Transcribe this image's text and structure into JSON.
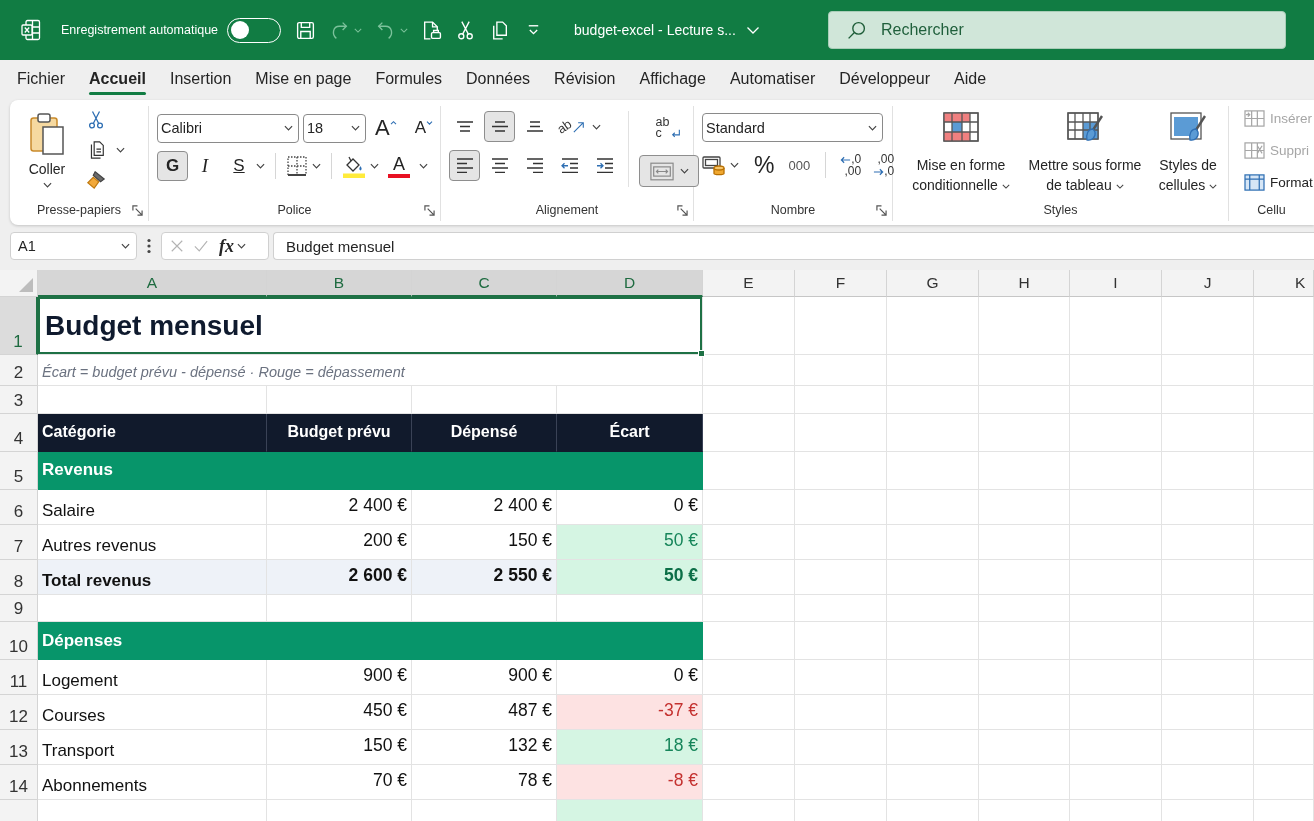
{
  "title_bar": {
    "autosave_label": "Enregistrement automatique",
    "autosave_on": false,
    "quick_access": [
      {
        "kind": "save",
        "disabled": false,
        "caret": false
      },
      {
        "kind": "redo",
        "disabled": true,
        "caret": true
      },
      {
        "kind": "undo",
        "disabled": true,
        "caret": true
      },
      {
        "kind": "print",
        "disabled": false,
        "caret": false
      },
      {
        "kind": "cut",
        "disabled": false,
        "caret": false
      },
      {
        "kind": "copy",
        "disabled": false,
        "caret": false
      },
      {
        "kind": "customize",
        "disabled": false,
        "caret": false
      }
    ],
    "document_title": "budget-excel - Lecture s...",
    "search_placeholder": "Rechercher"
  },
  "menu_tabs": [
    {
      "label": "Fichier",
      "selected": false
    },
    {
      "label": "Accueil",
      "selected": true
    },
    {
      "label": "Insertion",
      "selected": false
    },
    {
      "label": "Mise en page",
      "selected": false
    },
    {
      "label": "Formules",
      "selected": false
    },
    {
      "label": "Données",
      "selected": false
    },
    {
      "label": "Révision",
      "selected": false
    },
    {
      "label": "Affichage",
      "selected": false
    },
    {
      "label": "Automatiser",
      "selected": false
    },
    {
      "label": "Développeur",
      "selected": false
    },
    {
      "label": "Aide",
      "selected": false
    }
  ],
  "ribbon": {
    "groups": [
      {
        "kind": "clipboard",
        "label": "Presse-papiers",
        "launcher": true,
        "paste_label": "Coller"
      },
      {
        "kind": "font",
        "label": "Police",
        "launcher": true,
        "font_name": "Calibri",
        "font_size": "18",
        "grow_glyph": "A",
        "shrink_glyph": "A",
        "styles": [
          {
            "kind": "bold",
            "glyph": "G",
            "selected": true
          },
          {
            "kind": "italic",
            "glyph": "I",
            "selected": false
          },
          {
            "kind": "underline",
            "glyph": "S",
            "selected": false
          }
        ],
        "font_color_glyph": "A"
      },
      {
        "kind": "alignment",
        "label": "Alignement",
        "launcher": true,
        "vertical": [
          {
            "kind": "top",
            "selected": false
          },
          {
            "kind": "middle",
            "selected": true
          },
          {
            "kind": "bottom",
            "selected": false
          }
        ],
        "orientation_glyph": "ab",
        "horizontal": [
          {
            "kind": "left",
            "selected": true
          },
          {
            "kind": "center",
            "selected": false
          },
          {
            "kind": "right",
            "selected": false
          }
        ],
        "wrap_glyphs": [
          "ab",
          "c"
        ],
        "merge_selected": true
      },
      {
        "kind": "number",
        "label": "Nombre",
        "launcher": true,
        "format": "Standard",
        "percent": "%",
        "thousands": "000",
        "increase_decimal": [
          ",0",
          ",00"
        ],
        "decrease_decimal": [
          ",00",
          ",0"
        ]
      },
      {
        "kind": "styles",
        "label": "Styles",
        "launcher": false,
        "buttons": [
          {
            "kind": "conditional",
            "label": "Mise en forme conditionnelle"
          },
          {
            "kind": "table",
            "label": "Mettre sous forme de tableau"
          },
          {
            "kind": "cell",
            "label": "Styles de cellules"
          }
        ]
      },
      {
        "kind": "cells",
        "label": "Cellu",
        "launcher": false,
        "buttons": [
          {
            "kind": "insert",
            "label": "Insérer",
            "disabled": true
          },
          {
            "kind": "delete",
            "label": "Suppri",
            "disabled": true
          },
          {
            "kind": "format",
            "label": "Format",
            "disabled": false
          }
        ]
      }
    ]
  },
  "formula_bar": {
    "name_box": "A1",
    "function_glyph": "fx",
    "formula": "Budget mensuel"
  },
  "sheet": {
    "columns": [
      {
        "label": "A",
        "selected": true
      },
      {
        "label": "B",
        "selected": true
      },
      {
        "label": "C",
        "selected": true
      },
      {
        "label": "D",
        "selected": true
      },
      {
        "label": "E",
        "selected": false
      },
      {
        "label": "F",
        "selected": false
      },
      {
        "label": "G",
        "selected": false
      },
      {
        "label": "H",
        "selected": false
      },
      {
        "label": "I",
        "selected": false
      },
      {
        "label": "J",
        "selected": false
      },
      {
        "label": "K",
        "selected": false
      }
    ],
    "rows": [
      {
        "number": "1",
        "selected": true,
        "kind": "title",
        "text": "Budget mensuel"
      },
      {
        "number": "2",
        "selected": false,
        "kind": "note",
        "text": "Écart = budget prévu - dépensé · Rouge = dépassement"
      },
      {
        "number": "3",
        "selected": false,
        "kind": "blank"
      },
      {
        "number": "4",
        "selected": false,
        "kind": "header",
        "cells": [
          "Catégorie",
          "Budget prévu",
          "Dépensé",
          "Écart"
        ]
      },
      {
        "number": "5",
        "selected": false,
        "kind": "section",
        "text": "Revenus"
      },
      {
        "number": "6",
        "selected": false,
        "kind": "item",
        "category": "Salaire",
        "budget": "2 400 €",
        "spent": "2 400 €",
        "variance": "0 €",
        "over_budget": false,
        "under_budget": false
      },
      {
        "number": "7",
        "selected": false,
        "kind": "item",
        "category": "Autres revenus",
        "budget": "200 €",
        "spent": "150 €",
        "variance": "50 €",
        "over_budget": false,
        "under_budget": true
      },
      {
        "number": "8",
        "selected": false,
        "kind": "total",
        "category": "Total revenus",
        "budget": "2 600 €",
        "spent": "2 550 €",
        "variance": "50 €",
        "over_budget": false,
        "under_budget": true
      },
      {
        "number": "9",
        "selected": false,
        "kind": "blank"
      },
      {
        "number": "10",
        "selected": false,
        "kind": "section",
        "text": "Dépenses"
      },
      {
        "number": "11",
        "selected": false,
        "kind": "item",
        "category": "Logement",
        "budget": "900 €",
        "spent": "900 €",
        "variance": "0 €",
        "over_budget": false,
        "under_budget": false
      },
      {
        "number": "12",
        "selected": false,
        "kind": "item",
        "category": "Courses",
        "budget": "450 €",
        "spent": "487 €",
        "variance": "-37 €",
        "over_budget": true,
        "under_budget": false
      },
      {
        "number": "13",
        "selected": false,
        "kind": "item",
        "category": "Transport",
        "budget": "150 €",
        "spent": "132 €",
        "variance": "18 €",
        "over_budget": false,
        "under_budget": true
      },
      {
        "number": "14",
        "selected": false,
        "kind": "item",
        "category": "Abonnements",
        "budget": "70 €",
        "spent": "78 €",
        "variance": "-8 €",
        "over_budget": true,
        "under_budget": false
      },
      {
        "selected": false,
        "kind": "partial",
        "over_budget": false,
        "under_budget": true
      }
    ]
  }
}
